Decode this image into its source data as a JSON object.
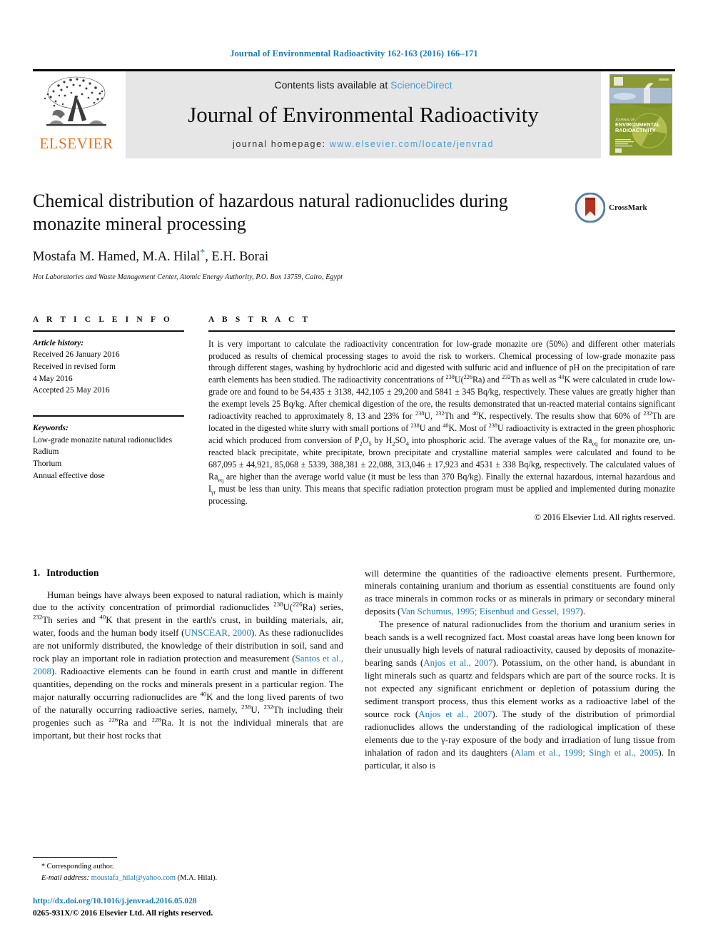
{
  "running_head": "Journal of Environmental Radioactivity 162-163 (2016) 166–171",
  "masthead": {
    "publisher": "ELSEVIER",
    "contents_prefix": "Contents lists available at ",
    "sciencedirect": "ScienceDirect",
    "journal_title": "Journal of Environmental Radioactivity",
    "homepage_prefix": "journal homepage: ",
    "homepage_url": "www.elsevier.com/locate/jenvrad",
    "cover_title_line1": "JOURNAL OF",
    "cover_title_line2": "ENVIRONMENTAL",
    "cover_title_line3": "RADIOACTIVITY"
  },
  "article": {
    "title": "Chemical distribution of hazardous natural radionuclides during monazite mineral processing",
    "authors": "Mostafa M. Hamed, M.A. Hilal",
    "authors_tail": ", E.H. Borai",
    "corresponding_marker": "*",
    "affiliation": "Hot Laboratories and Waste Management Center, Atomic Energy Authority, P.O. Box 13759, Cairo, Egypt",
    "crossmark_label": "CrossMark"
  },
  "article_info": {
    "label": "A R T I C L E    I N F O",
    "history_head": "Article history:",
    "history": [
      "Received 26 January 2016",
      "Received in revised form",
      "4 May 2016",
      "Accepted 25 May 2016"
    ],
    "keywords_head": "Keywords:",
    "keywords": [
      "Low-grade monazite natural radionuclides",
      "Radium",
      "Thorium",
      "Annual effective dose"
    ]
  },
  "abstract": {
    "label": "A B S T R A C T",
    "paragraphs": [
      "It is very important to calculate the radioactivity concentration for low-grade monazite ore (50%) and different other materials produced as results of chemical processing stages to avoid the risk to workers. Chemical processing of low-grade monazite pass through different stages, washing by hydrochloric acid and digested with sulfuric acid and influence of pH on the precipitation of rare earth elements has been studied. The radioactivity concentrations of 238U(226Ra) and 232Th as well as 40K were calculated in crude low-grade ore and found to be 54,435 ± 3138, 442,105 ± 29,200 and 5841 ± 345 Bq/kg, respectively. These values are greatly higher than the exempt levels 25 Bq/kg. After chemical digestion of the ore, the results demonstrated that un-reacted material contains significant radioactivity reached to approximately 8, 13 and 23% for 238U, 232Th and 40K, respectively. The results show that 60% of 232Th are located in the digested white slurry with small portions of 238U and 40K. Most of 238U radioactivity is extracted in the green phosphoric acid which produced from conversion of P2O5 by H2SO4 into phosphoric acid. The average values of the Raeq for monazite ore, un-reacted black precipitate, white precipitate, brown precipitate and crystalline material samples were calculated and found to be 687,095 ± 44,921, 85,068 ± 5339, 388,381 ± 22,088, 313,046 ± 17,923 and 4531 ± 338 Bq/kg, respectively. The calculated values of Raeq are higher than the average world value (it must be less than 370 Bq/kg). Finally the external hazardous, internal hazardous and Iγr must be less than unity. This means that specific radiation protection program must be applied and implemented during monazite processing."
    ],
    "copyright": "© 2016 Elsevier Ltd. All rights reserved."
  },
  "introduction": {
    "number": "1.",
    "heading": "Introduction",
    "left_paragraph": "Human beings have always been exposed to natural radiation, which is mainly due to the activity concentration of primordial radionuclides 238U(226Ra) series, 232Th series and 40K that present in the earth's crust, in building materials, air, water, foods and the human body itself (UNSCEAR, 2000). As these radionuclides are not uniformly distributed, the knowledge of their distribution in soil, sand and rock play an important role in radiation protection and measurement (Santos et al., 2008). Radioactive elements can be found in earth crust and mantle in different quantities, depending on the rocks and minerals present in a particular region. The major naturally occurring radionuclides are 40K and the long lived parents of two of the naturally occurring radioactive series, namely, 238U, 232Th including their progenies such as 226Ra and 228Ra. It is not the individual minerals that are important, but their host rocks that",
    "right_paragraph_1": "will determine the quantities of the radioactive elements present. Furthermore, minerals containing uranium and thorium as essential constituents are found only as trace minerals in common rocks or as minerals in primary or secondary mineral deposits (Van Schumus, 1995; Eisenbud and Gessel, 1997).",
    "right_paragraph_2": "The presence of natural radionuclides from the thorium and uranium series in beach sands is a well recognized fact. Most coastal areas have long been known for their unusually high levels of natural radioactivity, caused by deposits of monazite-bearing sands (Anjos et al., 2007). Potassium, on the other hand, is abundant in light minerals such as quartz and feldspars which are part of the source rocks. It is not expected any significant enrichment or depletion of potassium during the sediment transport process, thus this element works as a radioactive label of the source rock (Anjos et al., 2007). The study of the distribution of primordial radionuclides allows the understanding of the radiological implication of these elements due to the γ-ray exposure of the body and irradiation of lung tissue from inhalation of radon and its daughters (Alam et al., 1999; Singh et al., 2005). In particular, it also is",
    "references_inline": [
      "UNSCEAR, 2000",
      "Santos et al., 2008",
      "Van Schumus, 1995; Eisenbud and Gessel, 1997",
      "Anjos et al., 2007",
      "Alam et al., 1999; Singh et al., 2005"
    ]
  },
  "footnote": {
    "corresponding_star": "*",
    "corresponding_text": "Corresponding author.",
    "email_label": "E-mail address:",
    "email": "moustafa_hilal@yahoo.com",
    "email_owner": "(M.A. Hilal).",
    "doi": "http://dx.doi.org/10.1016/j.jenvrad.2016.05.028",
    "issn_line": "0265-931X/© 2016 Elsevier Ltd. All rights reserved."
  },
  "colors": {
    "link_blue": "#1a7bb9",
    "sciencedirect_blue": "#4a9cd6",
    "elsevier_orange": "#E9711C",
    "masthead_grey": "#e6e6e6"
  }
}
